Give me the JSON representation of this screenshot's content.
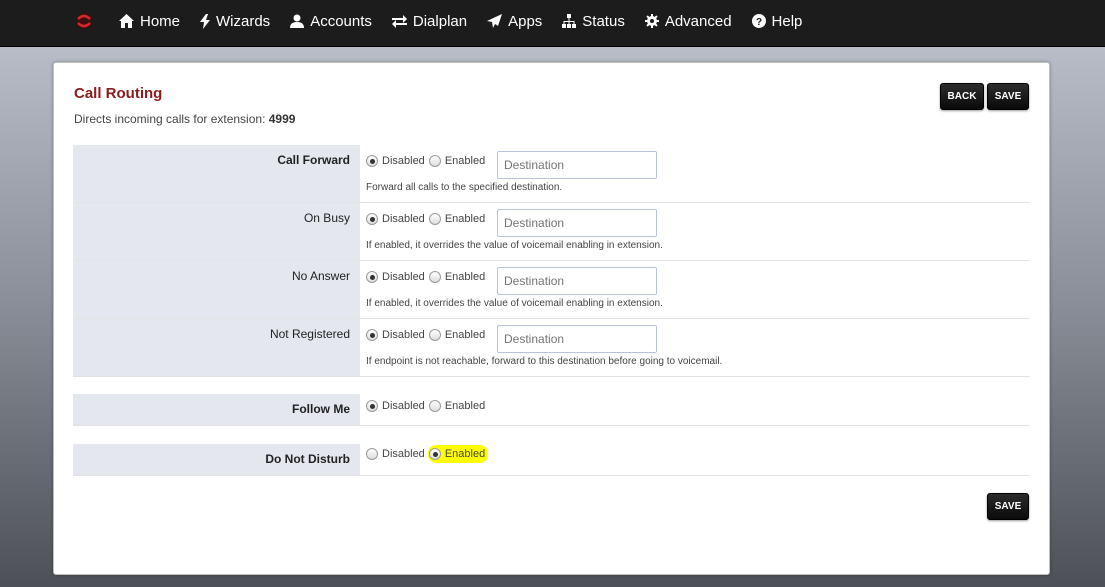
{
  "nav": {
    "items": [
      {
        "label": "Home",
        "icon": "home-icon"
      },
      {
        "label": "Wizards",
        "icon": "bolt-icon"
      },
      {
        "label": "Accounts",
        "icon": "user-icon"
      },
      {
        "label": "Dialplan",
        "icon": "exchange-icon"
      },
      {
        "label": "Apps",
        "icon": "send-icon"
      },
      {
        "label": "Status",
        "icon": "sitemap-icon"
      },
      {
        "label": "Advanced",
        "icon": "gear-icon"
      },
      {
        "label": "Help",
        "icon": "question-circle-icon"
      }
    ]
  },
  "page": {
    "title": "Call Routing",
    "subtitle_prefix": "Directs incoming calls for extension: ",
    "extension": "4999"
  },
  "buttons": {
    "back": "BACK",
    "save": "SAVE"
  },
  "rows": [
    {
      "label": "Call Forward",
      "bold": true,
      "disabled_label": "Disabled",
      "enabled_label": "Enabled",
      "selected": "disabled",
      "destination_placeholder": "Destination",
      "help": "Forward all calls to the specified destination."
    },
    {
      "label": "On Busy",
      "bold": false,
      "disabled_label": "Disabled",
      "enabled_label": "Enabled",
      "selected": "disabled",
      "destination_placeholder": "Destination",
      "help": "If enabled, it overrides the value of voicemail enabling in extension."
    },
    {
      "label": "No Answer",
      "bold": false,
      "disabled_label": "Disabled",
      "enabled_label": "Enabled",
      "selected": "disabled",
      "destination_placeholder": "Destination",
      "help": "If enabled, it overrides the value of voicemail enabling in extension."
    },
    {
      "label": "Not Registered",
      "bold": false,
      "disabled_label": "Disabled",
      "enabled_label": "Enabled",
      "selected": "disabled",
      "destination_placeholder": "Destination",
      "help": "If endpoint is not reachable, forward to this destination before going to voicemail."
    },
    {
      "label": "Follow Me",
      "bold": true,
      "disabled_label": "Disabled",
      "enabled_label": "Enabled",
      "selected": "disabled"
    },
    {
      "label": "Do Not Disturb",
      "bold": true,
      "disabled_label": "Disabled",
      "enabled_label": "Enabled",
      "selected": "enabled"
    }
  ],
  "colors": {
    "title": "#8b1c1c",
    "label_bg": "#e4e8ee",
    "highlight": "#ffff00",
    "navbar": "#1c1c1c"
  }
}
